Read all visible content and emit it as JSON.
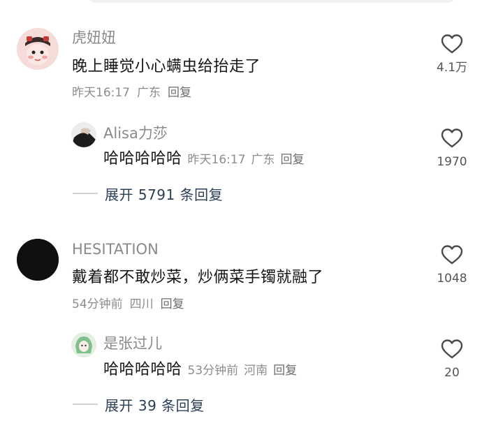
{
  "comments": [
    {
      "username": "虎妞妞",
      "text": "晚上睡觉小心螨虫给抬走了",
      "time": "昨天16:17",
      "location": "广东",
      "reply_label": "回复",
      "likes": "4.1万",
      "replies": [
        {
          "username": "Alisa力莎",
          "text": "哈哈哈哈哈",
          "time": "昨天16:17",
          "location": "广东",
          "reply_label": "回复",
          "likes": "1970"
        }
      ],
      "expand_label": "展开 5791 条回复"
    },
    {
      "username": "HESITATION",
      "text": "戴着都不敢炒菜，炒俩菜手镯就融了",
      "time": "54分钟前",
      "location": "四川",
      "reply_label": "回复",
      "likes": "1048",
      "replies": [
        {
          "username": "是张过儿",
          "text": "哈哈哈哈哈",
          "time": "53分钟前",
          "location": "河南",
          "reply_label": "回复",
          "likes": "20"
        }
      ],
      "expand_label": "展开 39 条回复"
    }
  ],
  "icons": {
    "like": "heart-outline-icon"
  },
  "colors": {
    "expand_text": "#2c3e57",
    "username": "#8a8a8a",
    "meta": "#8d8d8d"
  }
}
